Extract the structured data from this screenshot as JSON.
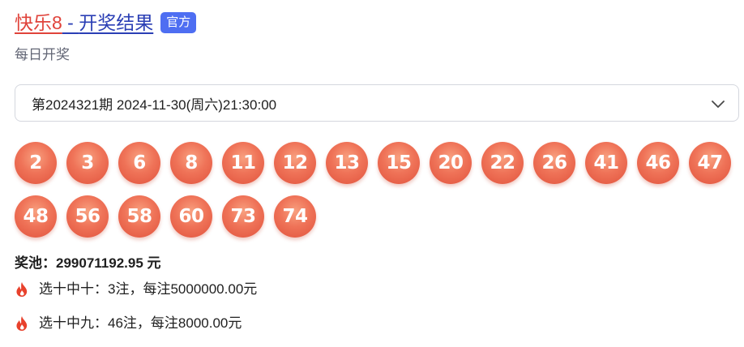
{
  "header": {
    "title_part1": "快乐8",
    "title_separator": " - ",
    "title_part2": "开奖结果",
    "badge": "官方",
    "subtitle": "每日开奖"
  },
  "period_select": {
    "value": "第2024321期 2024-11-30(周六)21:30:00",
    "icon": "chevron-down-icon"
  },
  "numbers": [
    "2",
    "3",
    "6",
    "8",
    "11",
    "12",
    "13",
    "15",
    "20",
    "22",
    "26",
    "41",
    "46",
    "47",
    "48",
    "56",
    "58",
    "60",
    "73",
    "74"
  ],
  "pool": {
    "label": "奖池：",
    "value": "299071192.95 元"
  },
  "prizes": [
    {
      "icon": "fire-icon",
      "text": "选十中十：3注，每注5000000.00元"
    },
    {
      "icon": "fire-icon",
      "text": "选十中九：46注，每注8000.00元"
    }
  ],
  "colors": {
    "title_red": "#e0433b",
    "title_blue": "#2b3fb5",
    "badge": "#4e6ef2",
    "ball": "#ef7358",
    "fire": "#e8412c"
  }
}
